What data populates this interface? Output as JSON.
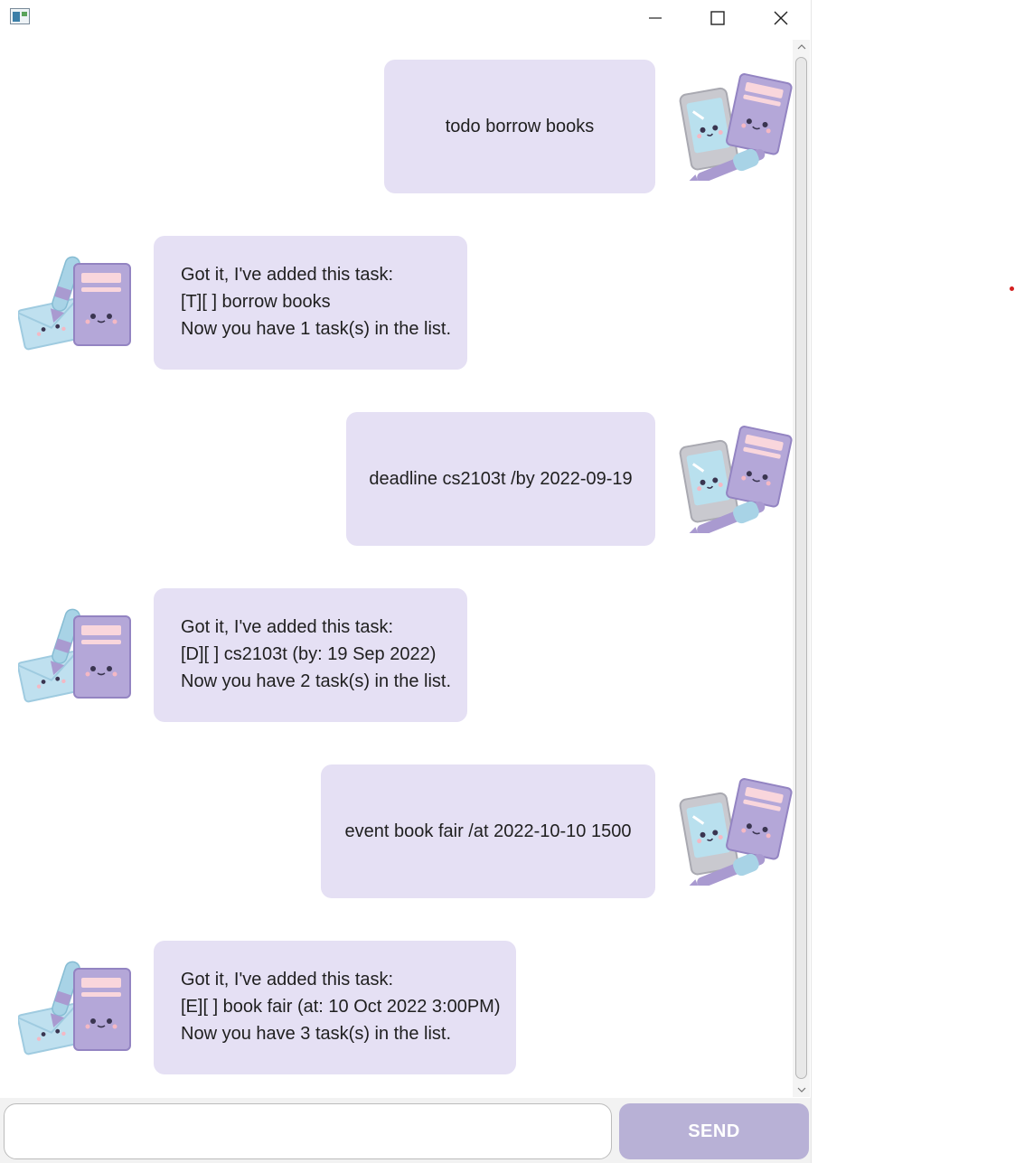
{
  "window": {
    "buttons": [
      "minimize",
      "maximize",
      "close"
    ]
  },
  "messages": [
    {
      "sender": "user",
      "lines": [
        "todo borrow books"
      ]
    },
    {
      "sender": "bot",
      "lines": [
        "Got it, I've added this task:",
        "[T][ ] borrow books",
        "Now you have 1 task(s) in the list."
      ]
    },
    {
      "sender": "user",
      "lines": [
        "deadline cs2103t /by 2022-09-19"
      ]
    },
    {
      "sender": "bot",
      "lines": [
        "Got it, I've added this task:",
        "[D][ ] cs2103t (by: 19 Sep 2022)",
        "Now you have 2 task(s) in the list."
      ]
    },
    {
      "sender": "user",
      "lines": [
        "event book fair /at 2022-10-10 1500"
      ]
    },
    {
      "sender": "bot",
      "lines": [
        "Got it, I've added this task:",
        "[E][ ] book fair (at: 10 Oct 2022 3:00PM)",
        "Now you have 3 task(s) in the list."
      ]
    }
  ],
  "input": {
    "value": "",
    "placeholder": ""
  },
  "send_button": {
    "label": "SEND"
  },
  "colors": {
    "bubble": "#e5e0f4",
    "send_button": "#b8b1d6",
    "accent_purple": "#a99ad0",
    "accent_blue": "#a8d3e6",
    "accent_pink": "#f7d0d6"
  },
  "icons": {
    "user_avatar": "phone-and-notebook-icon",
    "bot_avatar": "envelope-pen-notebook-icon"
  }
}
